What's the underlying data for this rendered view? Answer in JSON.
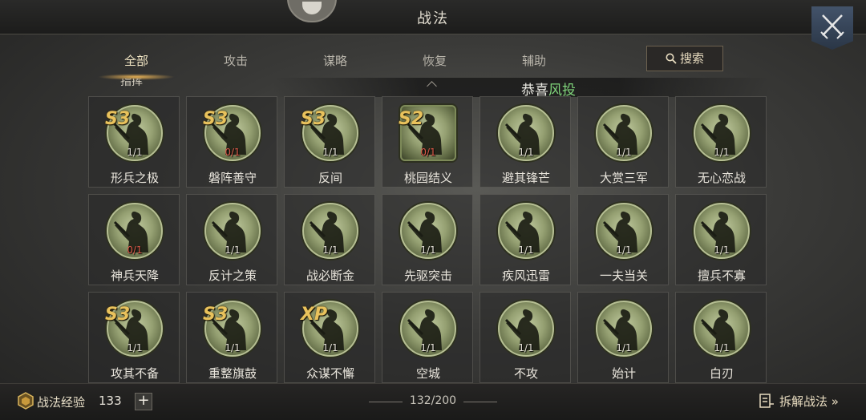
{
  "header": {
    "title": "战法"
  },
  "tabs": [
    {
      "label": "全部",
      "active": true
    },
    {
      "label": "攻击",
      "active": false
    },
    {
      "label": "谋略",
      "active": false
    },
    {
      "label": "恢复",
      "active": false
    },
    {
      "label": "辅助",
      "active": false
    }
  ],
  "search": {
    "label": "搜索",
    "icon": "search-icon"
  },
  "marquee": {
    "cut_text": "指挥",
    "prefix": "恭喜",
    "player_name": "风投"
  },
  "tactics": [
    {
      "name": "形兵之极",
      "level": "S3",
      "count": "1/1"
    },
    {
      "name": "磐阵善守",
      "level": "S3",
      "count": "0/1"
    },
    {
      "name": "反间",
      "level": "S3",
      "count": "1/1"
    },
    {
      "name": "桃园结义",
      "level": "S2",
      "count": "0/1"
    },
    {
      "name": "避其锋芒",
      "level": "",
      "count": "1/1"
    },
    {
      "name": "大赏三军",
      "level": "",
      "count": "1/1"
    },
    {
      "name": "无心恋战",
      "level": "",
      "count": "1/1"
    },
    {
      "name": "神兵天降",
      "level": "",
      "count": "0/1"
    },
    {
      "name": "反计之策",
      "level": "",
      "count": "1/1"
    },
    {
      "name": "战必断金",
      "level": "",
      "count": "1/1"
    },
    {
      "name": "先驱突击",
      "level": "",
      "count": "1/1"
    },
    {
      "name": "疾风迅雷",
      "level": "",
      "count": "1/1"
    },
    {
      "name": "一夫当关",
      "level": "",
      "count": "1/1"
    },
    {
      "name": "擅兵不寡",
      "level": "",
      "count": "1/1"
    },
    {
      "name": "攻其不备",
      "level": "S3",
      "count": "1/1"
    },
    {
      "name": "重整旗鼓",
      "level": "S3",
      "count": "1/1"
    },
    {
      "name": "众谋不懈",
      "level": "XP",
      "count": "1/1"
    },
    {
      "name": "空城",
      "level": "",
      "count": "1/1"
    },
    {
      "name": "不攻",
      "level": "",
      "count": "1/1"
    },
    {
      "name": "始计",
      "level": "",
      "count": "1/1"
    },
    {
      "name": "白刃",
      "level": "",
      "count": "1/1"
    }
  ],
  "footer": {
    "exp_label": "战法经验",
    "exp_value": "133",
    "plus": "+",
    "capacity": "132/200",
    "decompose_label": "拆解战法 »"
  },
  "colors": {
    "tab_active_glow": "#e8b256",
    "level_gold": "#e9c25c",
    "count_zero_red": "#e05a4a",
    "player_name_green": "#7fd37a",
    "close_button_blue": "#43536a"
  }
}
